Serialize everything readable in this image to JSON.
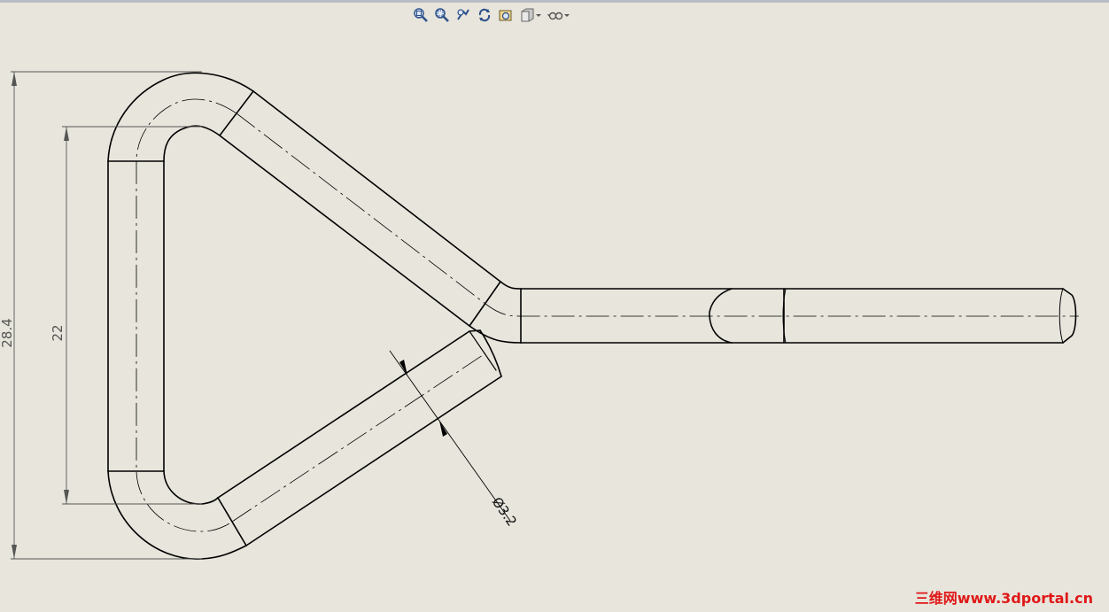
{
  "toolbar": {
    "items": [
      {
        "name": "zoom-to-fit-icon"
      },
      {
        "name": "zoom-to-area-icon"
      },
      {
        "name": "zoom-in-out-icon"
      },
      {
        "name": "rotate-view-icon"
      },
      {
        "name": "previous-view-icon"
      },
      {
        "name": "display-style-icon"
      },
      {
        "name": "hide-show-items-icon"
      }
    ]
  },
  "dimensions": {
    "overall_height": "28.4",
    "inner_height": "22",
    "wire_diameter": "Ø3.2"
  },
  "watermark": {
    "text": "三维网www.3dportal.cn",
    "color": "#e01818"
  },
  "colors": {
    "background": "#e7e5dc",
    "geometry": "#000000",
    "dimension": "#555555"
  }
}
